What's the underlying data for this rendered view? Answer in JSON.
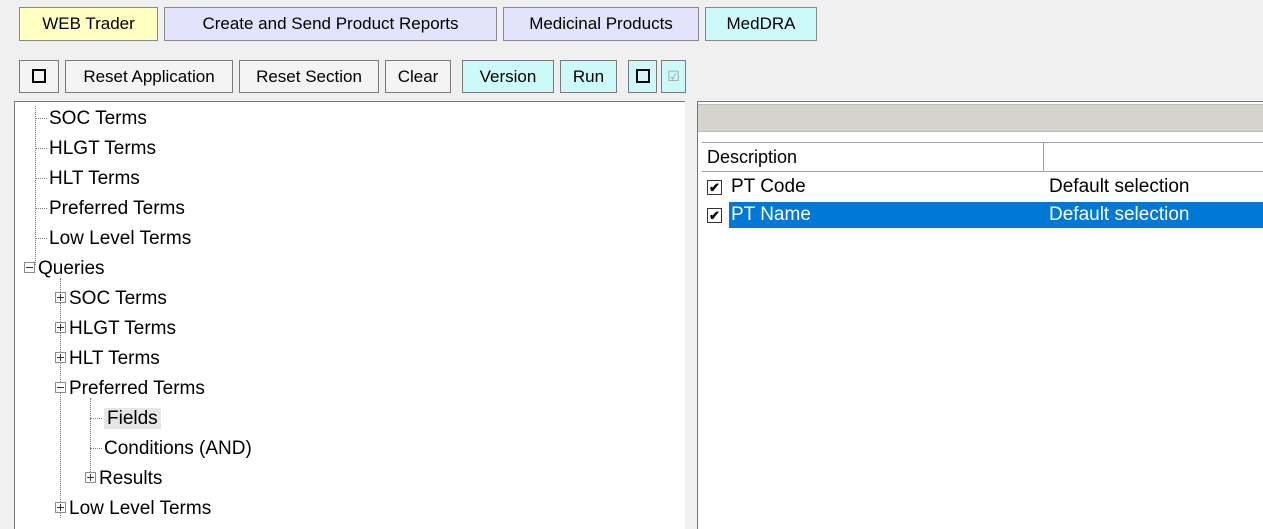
{
  "tabs": [
    {
      "label": "WEB Trader"
    },
    {
      "label": "Create and Send Product Reports"
    },
    {
      "label": "Medicinal Products"
    },
    {
      "label": "MedDRA"
    }
  ],
  "toolbar": {
    "reset_application": "Reset Application",
    "reset_section": "Reset Section",
    "clear": "Clear",
    "version": "Version",
    "run": "Run",
    "check_glyph": "☑"
  },
  "tree": {
    "soc_terms": "SOC Terms",
    "hlgt_terms": "HLGT Terms",
    "hlt_terms": "HLT Terms",
    "preferred_terms": "Preferred Terms",
    "low_level_terms": "Low Level Terms",
    "queries": "Queries",
    "q_soc_terms": "SOC Terms",
    "q_hlgt_terms": "HLGT Terms",
    "q_hlt_terms": "HLT Terms",
    "q_preferred_terms": "Preferred Terms",
    "fields": "Fields",
    "conditions": "Conditions (AND)",
    "results": "Results",
    "q_low_level_terms": "Low Level Terms"
  },
  "grid": {
    "columns": [
      "Description",
      ""
    ],
    "rows": [
      {
        "name": "PT Code",
        "value": "Default selection",
        "checked": true,
        "selected": false
      },
      {
        "name": "PT Name",
        "value": "Default selection",
        "checked": true,
        "selected": true
      }
    ],
    "check_mark": "✔"
  },
  "colors": {
    "tab_webtrader": "#ffffc2",
    "tab_lavender": "#e3e3fb",
    "tab_meddra": "#ccf9f9",
    "selection": "#0078d7"
  }
}
